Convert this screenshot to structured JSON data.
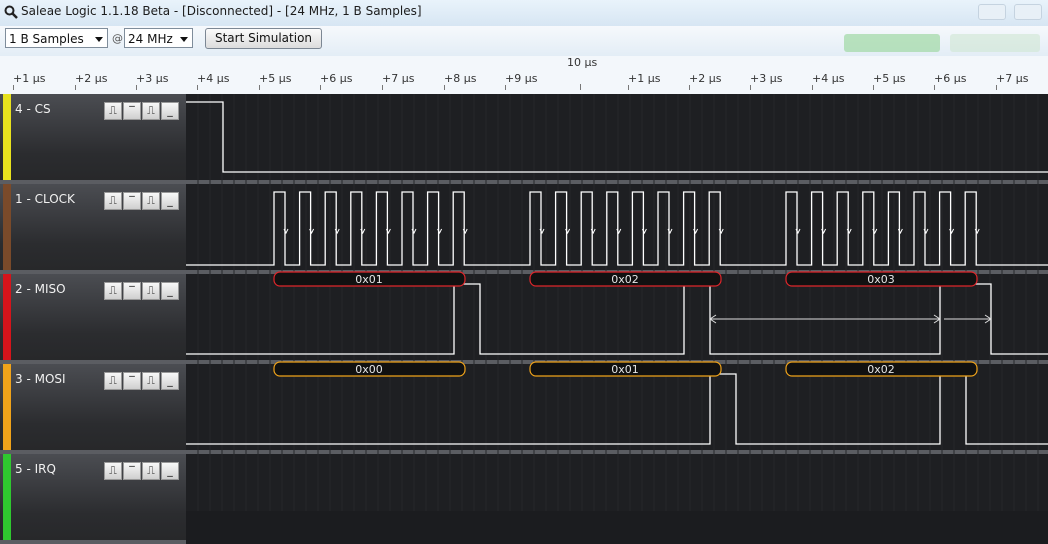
{
  "window": {
    "title": "Saleae Logic 1.1.18 Beta - [Disconnected] - [24 MHz, 1 B Samples]"
  },
  "toolbar": {
    "samples": "1 B Samples",
    "at": "@",
    "rate": "24 MHz",
    "start_label": "Start Simulation"
  },
  "ruler": {
    "center_label": "10 µs",
    "ticks": [
      "+1 µs",
      "+2 µs",
      "+3 µs",
      "+4 µs",
      "+5 µs",
      "+6 µs",
      "+7 µs",
      "+8 µs",
      "+9 µs",
      "+1 µs",
      "+2 µs",
      "+3 µs",
      "+4 µs",
      "+5 µs",
      "+6 µs",
      "+7 µs"
    ]
  },
  "trigger_buttons": [
    "⎍",
    "‾",
    "⎍",
    "_"
  ],
  "channels": [
    {
      "name": "4 - CS",
      "color": "#e8e21e",
      "decodes": []
    },
    {
      "name": "1 - CLOCK",
      "color": "#7a4a2a",
      "decodes": []
    },
    {
      "name": "2 - MISO",
      "color": "#d5141b",
      "decodes": [
        "0x01",
        "0x02",
        "0x03"
      ],
      "decode_color": "#e0262b"
    },
    {
      "name": "3 - MOSI",
      "color": "#f0a31a",
      "decodes": [
        "0x00",
        "0x01",
        "0x02"
      ],
      "decode_color": "#f0a31a"
    },
    {
      "name": "5 - IRQ",
      "color": "#2fc82f",
      "decodes": []
    }
  ]
}
